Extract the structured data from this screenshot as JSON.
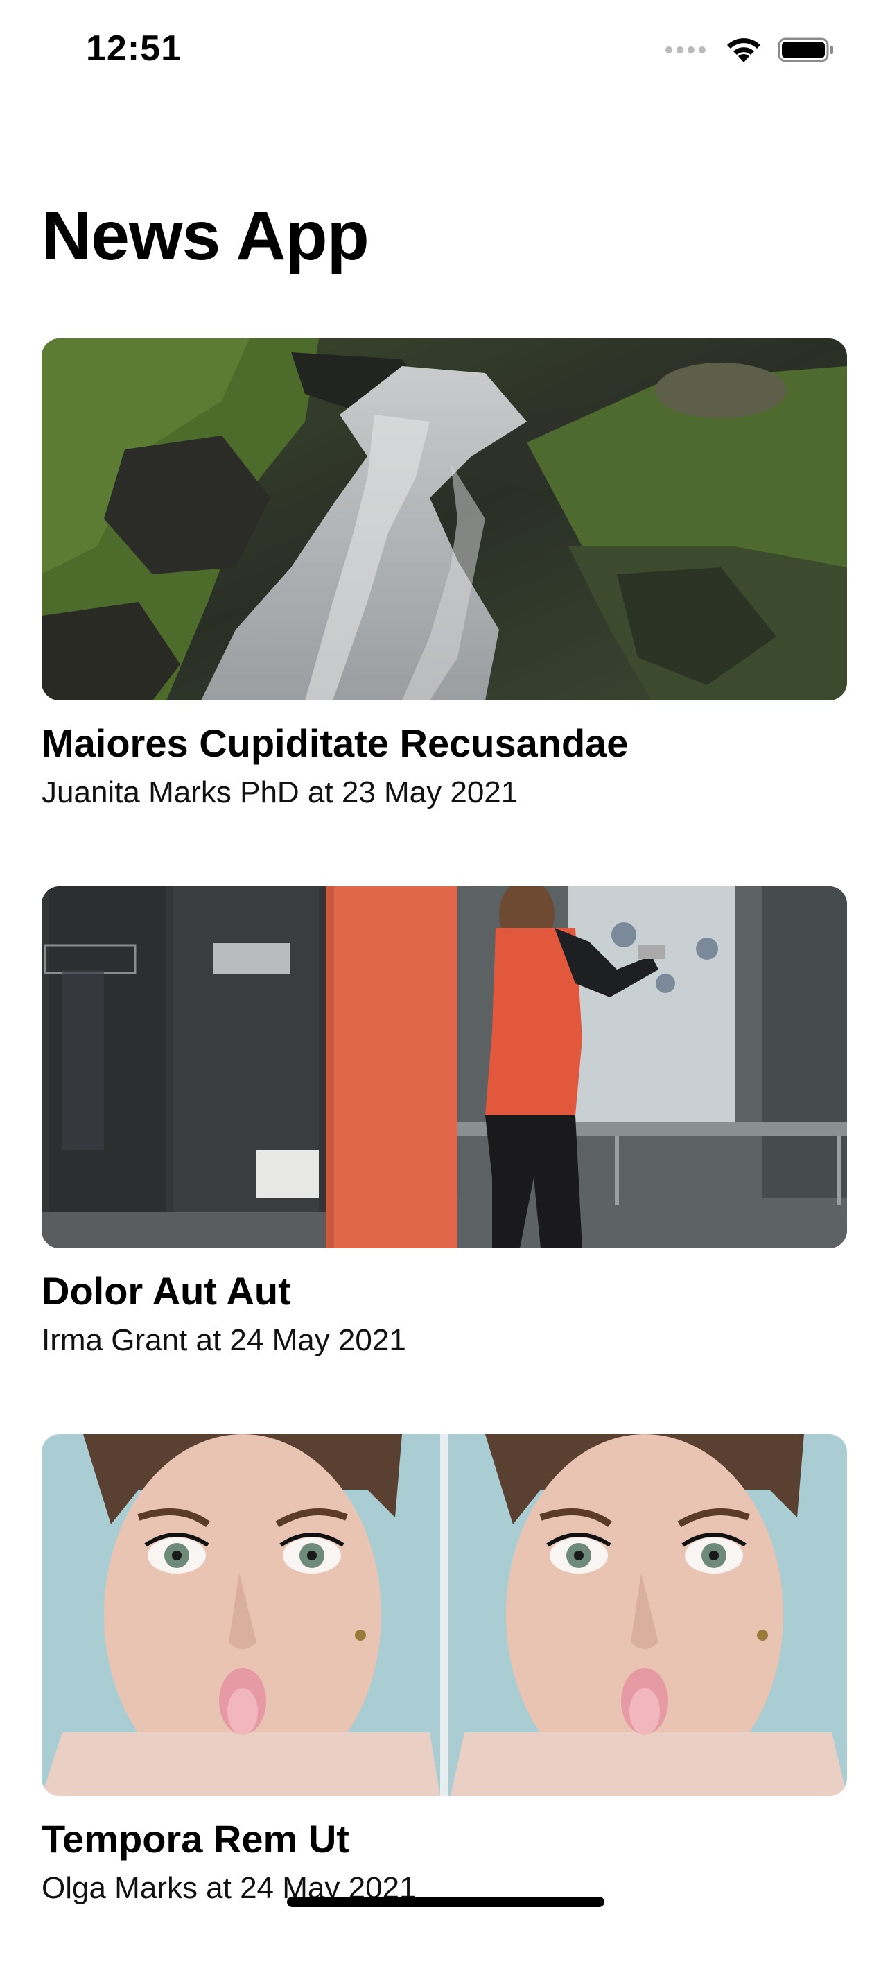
{
  "status_bar": {
    "time": "12:51",
    "icons": [
      "cellular-signal-icon",
      "wifi-icon",
      "battery-icon"
    ]
  },
  "header": {
    "title": "News App"
  },
  "articles": [
    {
      "title": "Maiores Cupiditate Recusandae",
      "meta": "Juanita Marks PhD at 23 May 2021",
      "image": "waterfall-photo"
    },
    {
      "title": "Dolor Aut Aut",
      "meta": "Irma Grant at 24 May 2021",
      "image": "storefront-woman-photo"
    },
    {
      "title": "Tempora Rem Ut",
      "meta": "Olga Marks at 24 May 2021",
      "image": "woman-face-photo"
    }
  ],
  "colors": {
    "background": "#ffffff",
    "text": "#000000"
  }
}
